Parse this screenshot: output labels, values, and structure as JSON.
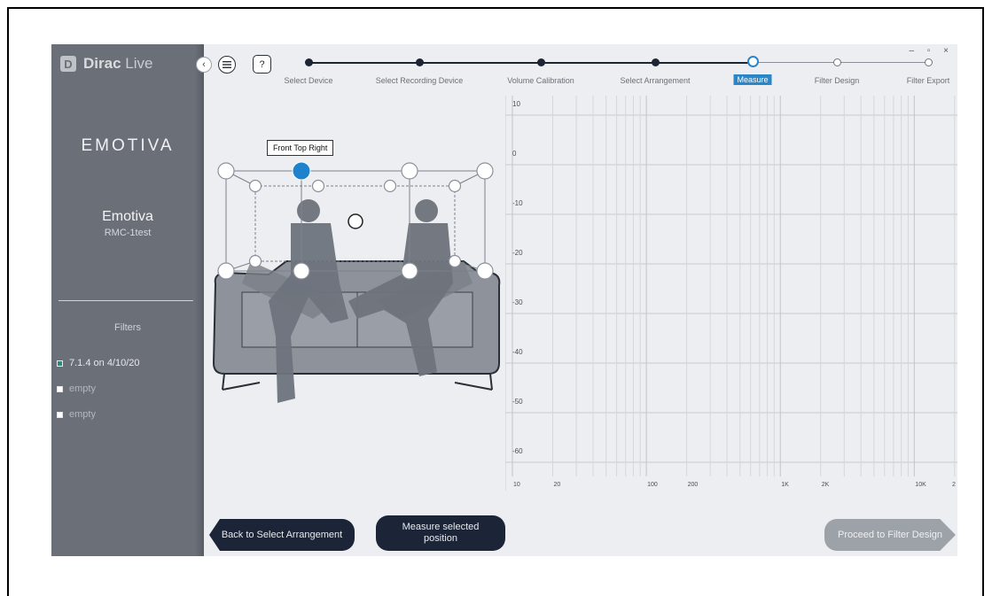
{
  "sidebar": {
    "brand_bold": "Dirac",
    "brand_light": "Live",
    "brand_logo": "D",
    "partner_logo": "EMOTIVA",
    "device_name": "Emotiva",
    "device_model": "RMC-1test",
    "filters_title": "Filters",
    "filters": [
      {
        "label": "7.1.4 on 4/10/20",
        "checked": true
      },
      {
        "label": "empty",
        "checked": false
      },
      {
        "label": "empty",
        "checked": false
      }
    ]
  },
  "toolbar": {
    "collapse_icon": "‹",
    "menu_icon": "≡",
    "help_icon": "?",
    "window_controls": "–  ▫  ×"
  },
  "steps": [
    {
      "label": "Select Device",
      "state": "done"
    },
    {
      "label": "Select Recording Device",
      "state": "done"
    },
    {
      "label": "Volume Calibration",
      "state": "done"
    },
    {
      "label": "Select Arrangement",
      "state": "done"
    },
    {
      "label": "Measure",
      "state": "current"
    },
    {
      "label": "Filter Design",
      "state": "todo"
    },
    {
      "label": "Filter Export",
      "state": "todo"
    }
  ],
  "arrangement": {
    "tooltip": "Front Top Right"
  },
  "graph": {
    "y_ticks": [
      "10",
      "0",
      "-10",
      "-20",
      "-30",
      "-40",
      "-50",
      "-60"
    ],
    "x_ticks": [
      "10",
      "20",
      "100",
      "200",
      "1K",
      "2K",
      "10K",
      "2"
    ]
  },
  "buttons": {
    "back": "Back to Select Arrangement",
    "measure": "Measure selected position",
    "proceed": "Proceed to Filter Design"
  },
  "colors": {
    "accent": "#2b86c9",
    "sidebar": "#6b6f77",
    "dark_button": "#1b2537",
    "check": "#2f8a78"
  }
}
